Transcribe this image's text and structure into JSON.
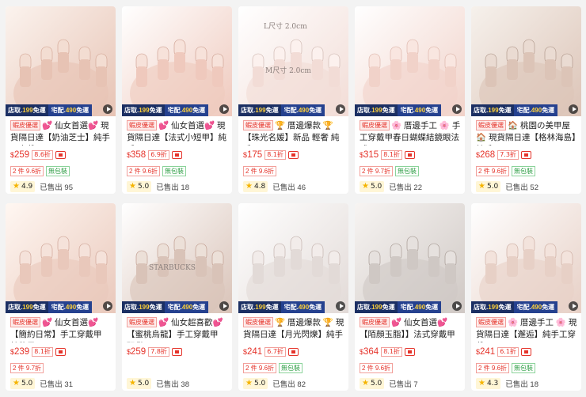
{
  "shipping": {
    "store_prefix": "店取.",
    "store_amount": "199",
    "store_suffix": "免運",
    "home_prefix": "宅配.",
    "home_amount": "490",
    "home_suffix": "免運"
  },
  "products": [
    {
      "promo": "蝦皮優選",
      "title": "💕 仙女首選💕 現貨隔日達【奶油芝士】純手工穿戴甲",
      "currency": "$",
      "price": "259",
      "discount": "8.6折",
      "tag_red": "2 件 9.6折",
      "tag_green": "無包裝",
      "rating": "4.9",
      "sold": "已售出 95",
      "image_label_1": "",
      "image_label_2": ""
    },
    {
      "promo": "蝦皮優選",
      "title": "💕 仙女首選💕 現貨隔日達【法式小短甲】純手工",
      "currency": "$",
      "price": "358",
      "discount": "6.9折",
      "tag_red": "2 件 9.6折",
      "tag_green": "無包裝",
      "rating": "5.0",
      "sold": "已售出 18",
      "image_label_1": "",
      "image_label_2": ""
    },
    {
      "promo": "蝦皮優選",
      "title": "🏆 厝邊爆款 🏆【珠光名媛】新品 輕奢 純手工",
      "currency": "$",
      "price": "175",
      "discount": "8.1折",
      "tag_red": "2 件 9.6折",
      "tag_green": "",
      "rating": "4.8",
      "sold": "已售出 46",
      "image_label_1": "L尺寸 2.0cm",
      "image_label_2": "M尺寸 2.0cm"
    },
    {
      "promo": "蝦皮優選",
      "title": "🌸 厝邊手工 🌸 手工穿戴甲春日蝴蝶結鏡眼法式",
      "currency": "$",
      "price": "315",
      "discount": "8.1折",
      "tag_red": "2 件 9.7折",
      "tag_green": "無包裝",
      "rating": "5.0",
      "sold": "已售出 22",
      "image_label_1": "",
      "image_label_2": ""
    },
    {
      "promo": "蝦皮優選",
      "title": "🏠 桃園の美甲屋 🏠 現貨隔日達【格林海島】純手工",
      "currency": "$",
      "price": "268",
      "discount": "7.3折",
      "tag_red": "2 件 9.6折",
      "tag_green": "無包裝",
      "rating": "5.0",
      "sold": "已售出 52",
      "image_label_1": "",
      "image_label_2": ""
    },
    {
      "promo": "蝦皮優選",
      "title": "💕 仙女首選💕【簡約日常】手工穿戴甲 純欲風",
      "currency": "$",
      "price": "239",
      "discount": "8.1折",
      "tag_red": "2 件 9.7折",
      "tag_green": "",
      "rating": "5.0",
      "sold": "已售出 31",
      "image_label_1": "",
      "image_label_2": ""
    },
    {
      "promo": "蝦皮優選",
      "title": "💕 仙女超喜歡💕【蜜桃烏龍】手工穿戴甲 現貨",
      "currency": "$",
      "price": "259",
      "discount": "7.8折",
      "tag_red": "",
      "tag_green": "",
      "rating": "5.0",
      "sold": "已售出 38",
      "image_label_1": "",
      "image_label_2": "STARBUCKS"
    },
    {
      "promo": "蝦皮優選",
      "title": "🏆 厝邊爆款 🏆 現貨隔日達【月光閃爍】純手工",
      "currency": "$",
      "price": "241",
      "discount": "6.7折",
      "tag_red": "2 件 9.6折",
      "tag_green": "無包裝",
      "rating": "5.0",
      "sold": "已售出 82",
      "image_label_1": "",
      "image_label_2": ""
    },
    {
      "promo": "蝦皮優選",
      "title": "💕 仙女首選💕【陌顏玉脂】】法式穿戴甲",
      "currency": "$",
      "price": "364",
      "discount": "8.1折",
      "tag_red": "2 件 9.6折",
      "tag_green": "",
      "rating": "5.0",
      "sold": "已售出 7",
      "image_label_1": "",
      "image_label_2": ""
    },
    {
      "promo": "蝦皮優選",
      "title": "🌸 厝邊手工 🌸 現貨隔日達【邂逅】純手工穿戴甲",
      "currency": "$",
      "price": "241",
      "discount": "6.1折",
      "tag_red": "2 件 9.6折",
      "tag_green": "無包裝",
      "rating": "4.3",
      "sold": "已售出 18",
      "image_label_1": "",
      "image_label_2": ""
    }
  ],
  "colors": {
    "price": "#e5332a",
    "ship_dark": "#1b2f63",
    "ship_blue": "#25418f",
    "ship_amount": "#ffd23a",
    "free_tag": "#2e9e45"
  },
  "icons": [
    "play-icon",
    "star-icon",
    "coupon-icon"
  ]
}
